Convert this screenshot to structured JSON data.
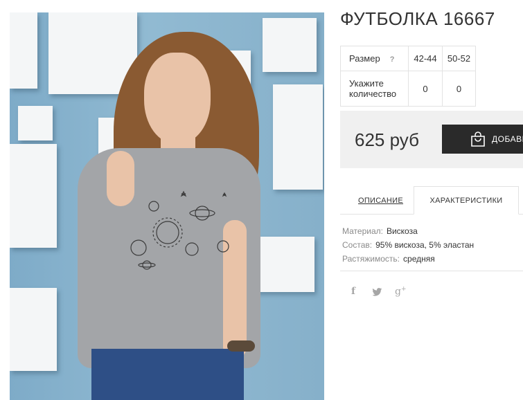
{
  "product": {
    "title": "ФУТБОЛКА 16667",
    "image_alt": "Серая футболка с принтом планет"
  },
  "size_table": {
    "size_label": "Размер",
    "help_mark": "?",
    "sizes": [
      "42-44",
      "50-52"
    ],
    "qty_label_line1": "Укажите",
    "qty_label_line2": "количество",
    "quantities": [
      "0",
      "0"
    ]
  },
  "purchase": {
    "price": "625 руб",
    "cart_button_label": "ДОБАВИТЬ",
    "cart_icon": "shopping-bag-icon"
  },
  "tabs": [
    {
      "label": "ОПИСАНИЕ",
      "active": false
    },
    {
      "label": "ХАРАКТЕРИСТИКИ",
      "active": true
    }
  ],
  "specs": [
    {
      "label": "Материал:",
      "value": "Вискоза"
    },
    {
      "label": "Состав:",
      "value": "95% вискоза, 5% эластан"
    },
    {
      "label": "Растяжимость:",
      "value": "средняя"
    }
  ],
  "social": [
    {
      "name": "facebook-icon",
      "glyph": "f"
    },
    {
      "name": "twitter-icon",
      "glyph": "🐦"
    },
    {
      "name": "google-plus-icon",
      "glyph": "g+"
    }
  ],
  "colors": {
    "button_bg": "#2a2a2a",
    "price_box_bg": "#f0f0f0",
    "border": "#e2e2e2",
    "photo_bg": "#84b0cb"
  }
}
